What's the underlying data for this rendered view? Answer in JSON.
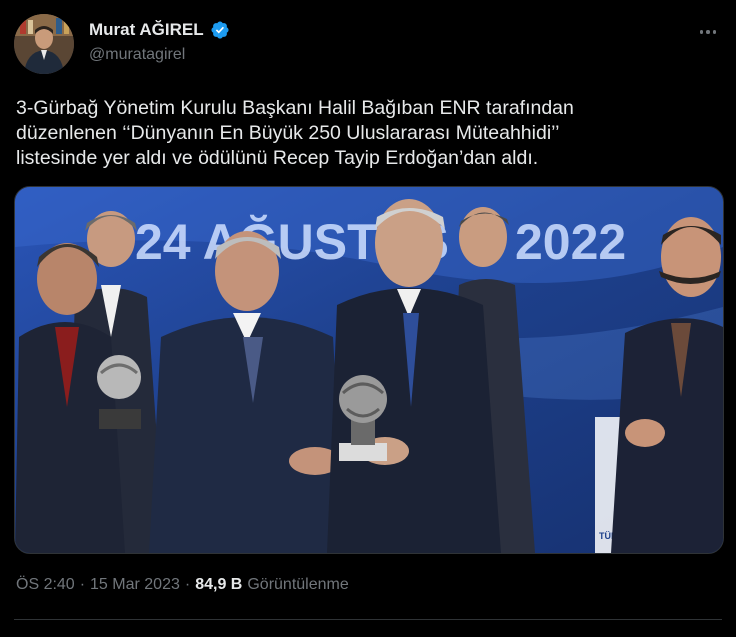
{
  "author": {
    "display_name": "Murat AĞIREL",
    "handle": "@muratagirel",
    "verified_icon": "verified-badge-icon"
  },
  "tweet": {
    "text": "3-Gürbağ Yönetim Kurulu Başkanı Halil Bağıban ENR tarafından\ndüzenlenen ‘‘Dünyanın En Büyük 250 Uluslararası Müteahhidi’’\nlistesinde yer aldı ve ödülünü Recep Tayip Erdoğan’dan aldı."
  },
  "photo": {
    "banner_text_left": "24 AĞUSTOS",
    "banner_text_right": "2022",
    "corner_text": "TÜR MÜTEAHHİT"
  },
  "meta": {
    "time": "ÖS 2:40",
    "separator": "·",
    "date": "15 Mar 2023",
    "separator2": "·",
    "views_count": "84,9 B",
    "views_label": "Görüntülenme"
  },
  "colors": {
    "background": "#000000",
    "text_primary": "#e7e9ea",
    "text_secondary": "#71767b",
    "verified_blue": "#1d9bf0",
    "border": "#2f3336"
  }
}
